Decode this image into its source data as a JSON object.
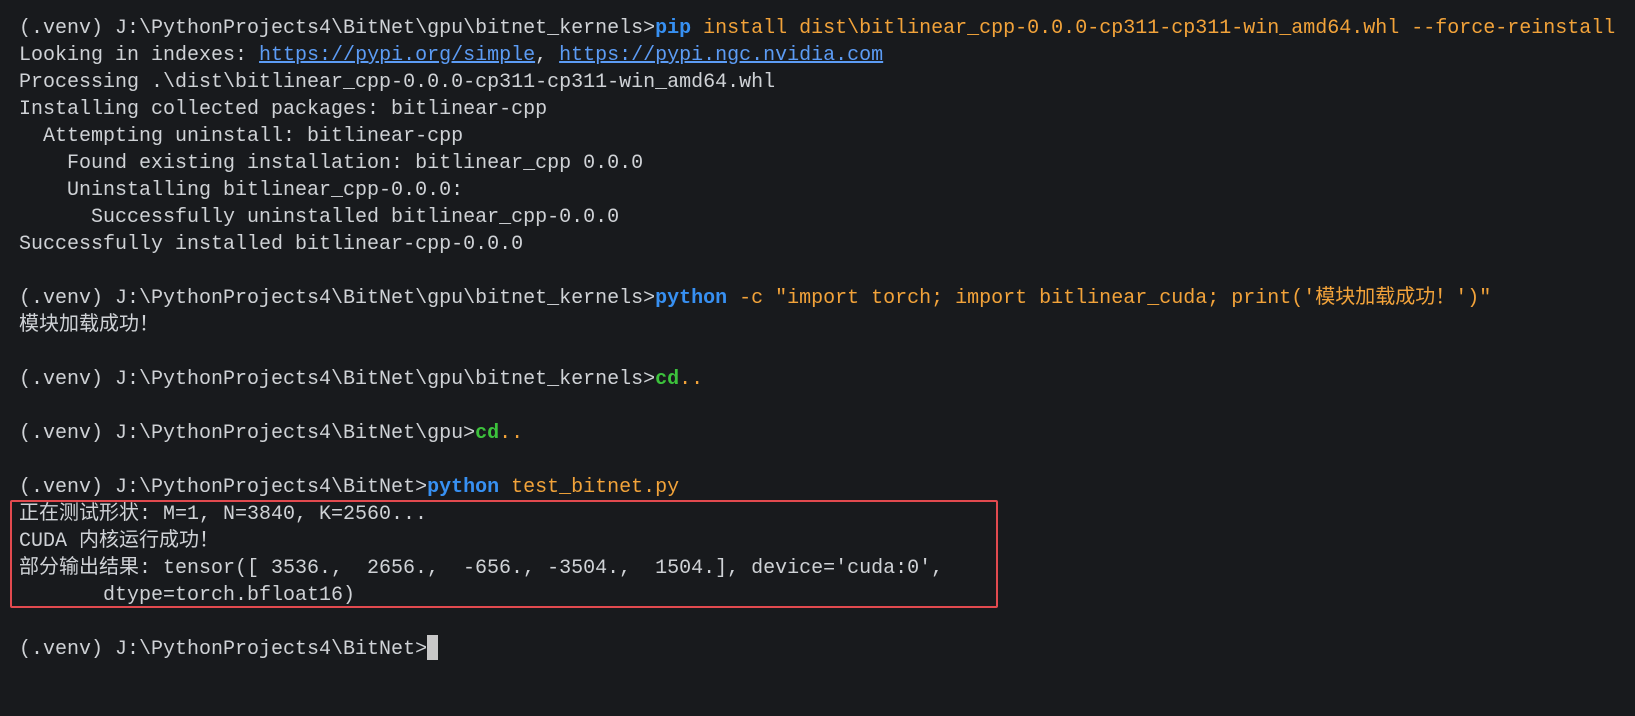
{
  "theme": {
    "background": "#181a1d",
    "foreground": "#cfd2d6",
    "command": "#3790f2",
    "argument": "#f2a33a",
    "builtin": "#3cc23c",
    "link": "#5c9cf5",
    "highlight_border": "#e24a4f",
    "cursor": "#c8c8c8"
  },
  "sessions": [
    {
      "prompt": "(.venv) J:\\PythonProjects4\\BitNet\\gpu\\bitnet_kernels>",
      "command": "pip",
      "args": " install dist\\bitlinear_cpp-0.0.0-cp311-cp311-win_amd64.whl --force-reinstall",
      "index_line": {
        "label": "Looking in indexes: ",
        "urls": [
          "https://pypi.org/simple",
          "https://pypi.ngc.nvidia.com"
        ],
        "separator": ", "
      },
      "output": [
        "Processing .\\dist\\bitlinear_cpp-0.0.0-cp311-cp311-win_amd64.whl",
        "Installing collected packages: bitlinear-cpp",
        "  Attempting uninstall: bitlinear-cpp",
        "    Found existing installation: bitlinear_cpp 0.0.0",
        "    Uninstalling bitlinear_cpp-0.0.0:",
        "      Successfully uninstalled bitlinear_cpp-0.0.0",
        "Successfully installed bitlinear-cpp-0.0.0"
      ]
    },
    {
      "prompt": "(.venv) J:\\PythonProjects4\\BitNet\\gpu\\bitnet_kernels>",
      "command": "python",
      "args": " -c \"import torch; import bitlinear_cuda; print('模块加载成功！')\"",
      "output": [
        "模块加载成功！"
      ]
    },
    {
      "prompt": "(.venv) J:\\PythonProjects4\\BitNet\\gpu\\bitnet_kernels>",
      "command": "cd",
      "args": ".."
    },
    {
      "prompt": "(.venv) J:\\PythonProjects4\\BitNet\\gpu>",
      "command": "cd",
      "args": ".."
    },
    {
      "prompt": "(.venv) J:\\PythonProjects4\\BitNet>",
      "command": "python",
      "args": " test_bitnet.py",
      "output": [
        "正在测试形状: M=1, N=3840, K=2560...",
        "CUDA 内核运行成功！",
        "部分输出结果: tensor([ 3536.,  2656.,  -656., -3504.,  1504.], device='cuda:0',",
        "       dtype=torch.bfloat16)"
      ]
    }
  ],
  "current_prompt": "(.venv) J:\\PythonProjects4\\BitNet>"
}
